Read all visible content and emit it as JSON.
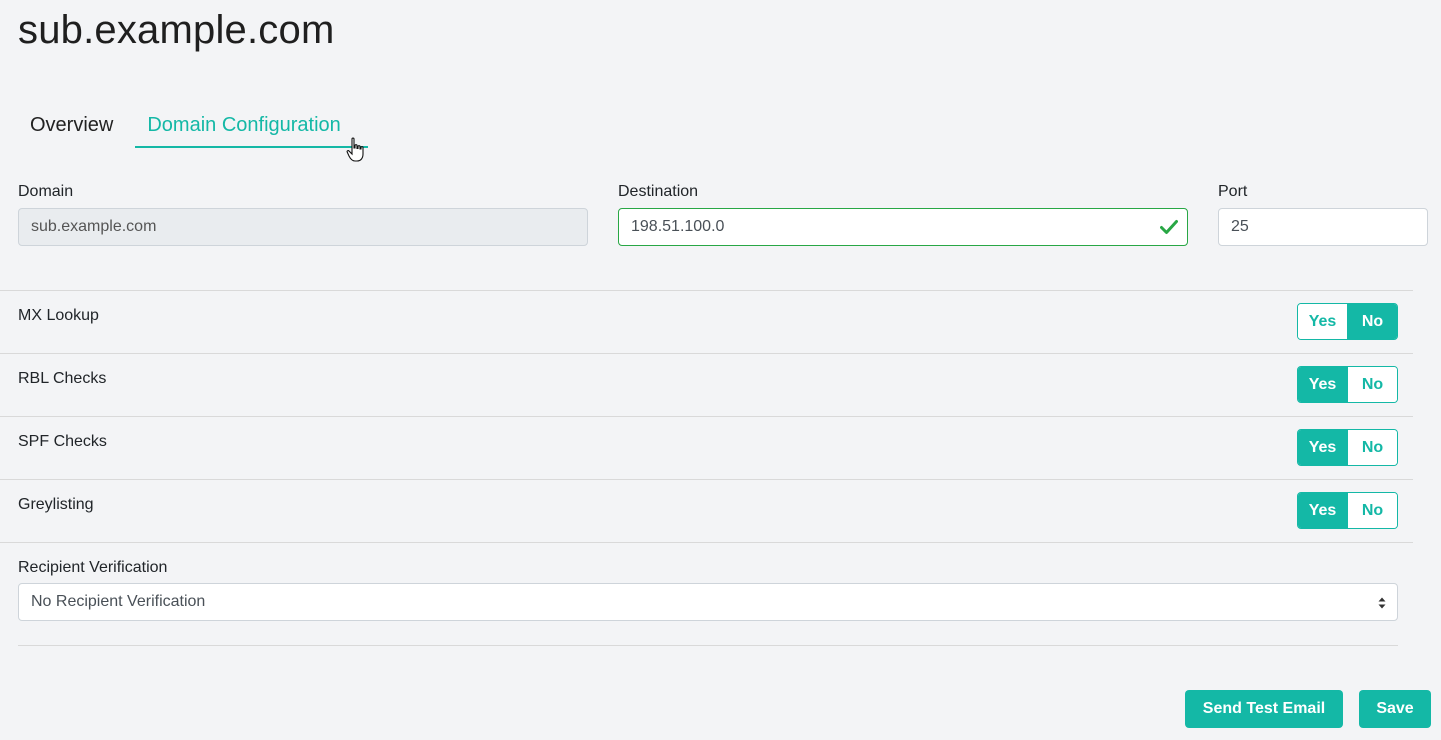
{
  "page": {
    "title": "sub.example.com"
  },
  "tabs": [
    {
      "label": "Overview",
      "active": false
    },
    {
      "label": "Domain Configuration",
      "active": true
    }
  ],
  "form": {
    "domain": {
      "label": "Domain",
      "value": "sub.example.com",
      "disabled": true
    },
    "destination": {
      "label": "Destination",
      "value": "198.51.100.0",
      "valid": true
    },
    "port": {
      "label": "Port",
      "value": "25"
    }
  },
  "toggles": [
    {
      "label": "MX Lookup",
      "yes": "Yes",
      "no": "No",
      "selected": "No"
    },
    {
      "label": "RBL Checks",
      "yes": "Yes",
      "no": "No",
      "selected": "Yes"
    },
    {
      "label": "SPF Checks",
      "yes": "Yes",
      "no": "No",
      "selected": "Yes"
    },
    {
      "label": "Greylisting",
      "yes": "Yes",
      "no": "No",
      "selected": "Yes"
    }
  ],
  "recipient_verification": {
    "label": "Recipient Verification",
    "selected": "No Recipient Verification"
  },
  "actions": {
    "send_test_email": "Send Test Email",
    "save": "Save"
  },
  "colors": {
    "accent": "#14b8a6",
    "valid": "#28a745",
    "background": "#f3f4f6"
  },
  "icons": {
    "valid": "check-icon",
    "select": "select-arrows-icon",
    "cursor": "hand-pointer-icon"
  }
}
